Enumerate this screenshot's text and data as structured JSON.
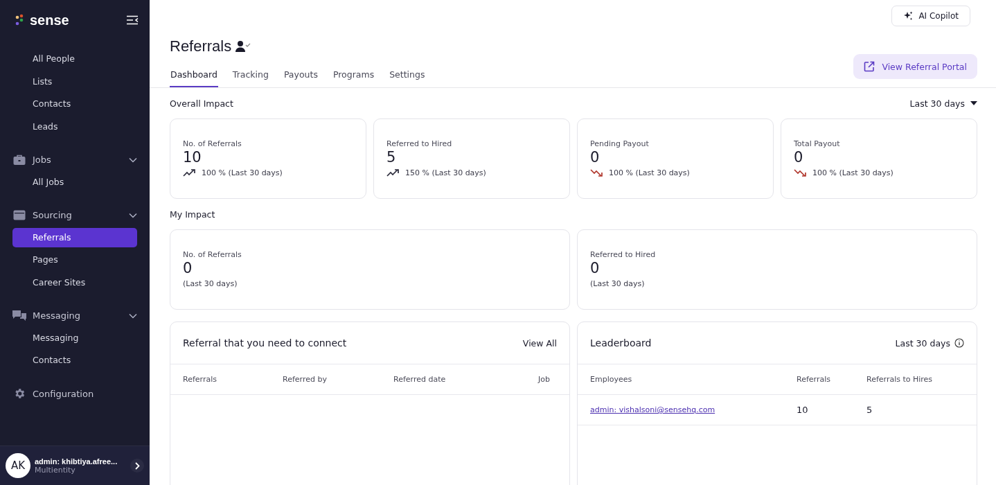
{
  "sidebar": {
    "logo": "sense",
    "sections": [
      {
        "kind": "list",
        "items": [
          {
            "label": "All People",
            "selected": false
          },
          {
            "label": "Lists",
            "selected": false
          },
          {
            "label": "Contacts",
            "selected": false
          },
          {
            "label": "Leads",
            "selected": false
          }
        ]
      },
      {
        "kind": "group",
        "label": "Jobs",
        "expanded": true,
        "items": [
          {
            "label": "All Jobs",
            "selected": false
          }
        ]
      },
      {
        "kind": "group",
        "label": "Sourcing",
        "expanded": true,
        "items": [
          {
            "label": "Referrals",
            "selected": true
          },
          {
            "label": "Pages",
            "selected": false
          },
          {
            "label": "Career Sites",
            "selected": false
          }
        ]
      },
      {
        "kind": "group",
        "label": "Messaging",
        "expanded": true,
        "items": [
          {
            "label": "Messaging",
            "selected": false
          },
          {
            "label": "Contacts",
            "selected": false
          }
        ]
      },
      {
        "kind": "link",
        "label": "Configuration"
      }
    ],
    "user": {
      "initials": "AK",
      "name": "admin: khibtiya.afree...",
      "org": "Multientity"
    }
  },
  "topbar": {
    "copilot": "AI Copilot"
  },
  "page": {
    "title": "Referrals",
    "portal_button": "View Referral Portal",
    "tabs": [
      {
        "label": "Dashboard",
        "selected": true
      },
      {
        "label": "Tracking",
        "selected": false
      },
      {
        "label": "Payouts",
        "selected": false
      },
      {
        "label": "Programs",
        "selected": false
      },
      {
        "label": "Settings",
        "selected": false
      }
    ]
  },
  "overall": {
    "title": "Overall Impact",
    "period": "Last 30 days",
    "cards": [
      {
        "label": "No. of Referrals",
        "value": "10",
        "kind": "up",
        "trend": "100 % (Last 30 days)"
      },
      {
        "label": "Referred to Hired",
        "value": "5",
        "kind": "up",
        "trend": "150 % (Last 30 days)"
      },
      {
        "label": "Pending Payout",
        "value": "0",
        "kind": "down",
        "trend": "100 % (Last 30 days)"
      },
      {
        "label": "Total Payout",
        "value": "0",
        "kind": "down",
        "trend": "100 % (Last 30 days)"
      }
    ]
  },
  "my_impact": {
    "title": "My Impact",
    "cards": [
      {
        "label": "No. of Referrals",
        "value": "0",
        "note": "(Last 30 days)"
      },
      {
        "label": "Referred to Hired",
        "value": "0",
        "note": "(Last 30 days)"
      }
    ]
  },
  "connect": {
    "title": "Referral that you need to connect",
    "link": "View All",
    "columns": [
      "Referrals",
      "Referred by",
      "Referred date",
      "Job"
    ]
  },
  "leaderboard": {
    "title": "Leaderboard",
    "period": "Last 30 days",
    "columns": [
      "Employees",
      "Referrals",
      "Referrals to Hires"
    ],
    "rows": [
      {
        "employee": "admin: vishalsoni@sensehq.com",
        "referrals": "10",
        "hires": "5"
      }
    ]
  }
}
